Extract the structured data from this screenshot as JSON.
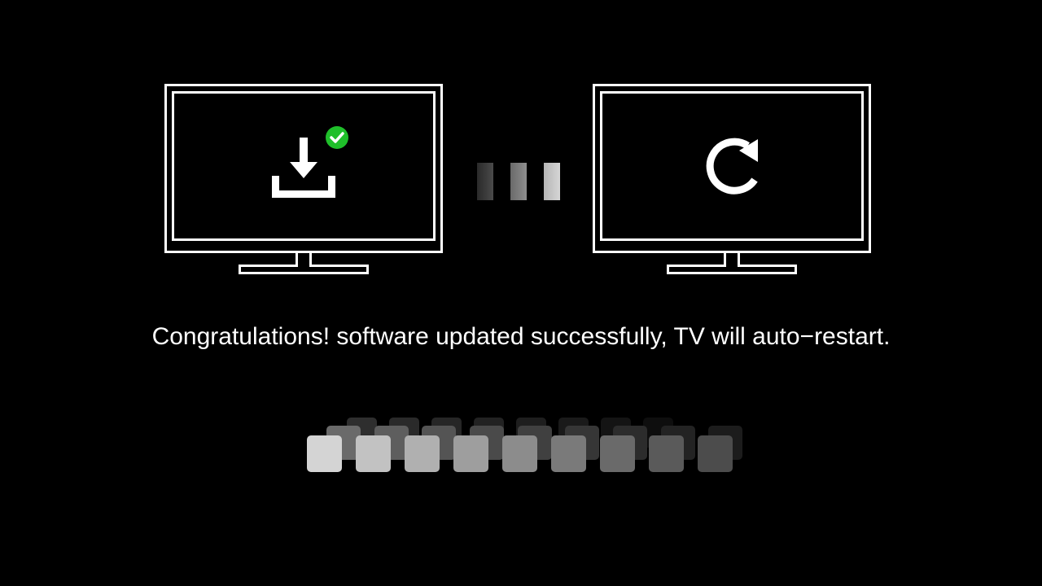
{
  "screen": {
    "background_color": "#000000",
    "foreground_color": "#ffffff"
  },
  "left_tv": {
    "icon": "download-icon",
    "badge_icon": "check-circle-icon",
    "badge_color": "#1fbf2a"
  },
  "right_tv": {
    "icon": "restart-icon"
  },
  "transition_indicator": {
    "icon": "progress-dots",
    "dot_count": 3
  },
  "message": {
    "text": "Congratulations! software updated successfully, TV will auto−restart."
  },
  "loading_animation": {
    "icon": "loading-tiles",
    "tile_count": 9
  }
}
